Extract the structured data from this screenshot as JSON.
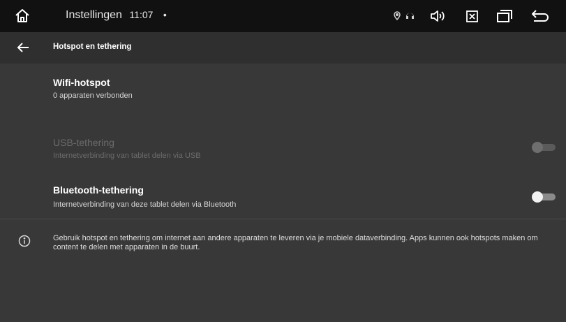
{
  "status_bar": {
    "app_name": "Instellingen",
    "time": "11:07",
    "dot": "•",
    "icons": [
      "home-icon",
      "location-icon",
      "headset-icon",
      "volume-icon",
      "close-box-icon",
      "recent-apps-icon",
      "back-nav-icon"
    ]
  },
  "toolbar": {
    "title": "Hotspot en tethering",
    "back_icon": "arrow-left-icon"
  },
  "settings": [
    {
      "title": "Wifi-hotspot",
      "subtitle": "0 apparaten verbonden",
      "enabled": true,
      "has_toggle": false
    },
    {
      "title": "USB-tethering",
      "subtitle": "Internetverbinding van tablet delen via USB",
      "enabled": false,
      "has_toggle": true,
      "toggle_on": false
    },
    {
      "title": "Bluetooth-tethering",
      "subtitle": "Internetverbinding van deze tablet delen via Bluetooth",
      "enabled": true,
      "has_toggle": true,
      "toggle_on": false
    }
  ],
  "info": {
    "icon": "info-icon",
    "text": "Gebruik hotspot en tethering om internet aan andere apparaten te leveren via je mobiele dataverbinding. Apps kunnen ook hotspots maken om content te delen met apparaten in de buurt."
  },
  "colors": {
    "status_bar_bg": "#111111",
    "toolbar_bg": "#2f2f2f",
    "page_bg": "#383838",
    "disabled_text": "#6b6b6b"
  }
}
